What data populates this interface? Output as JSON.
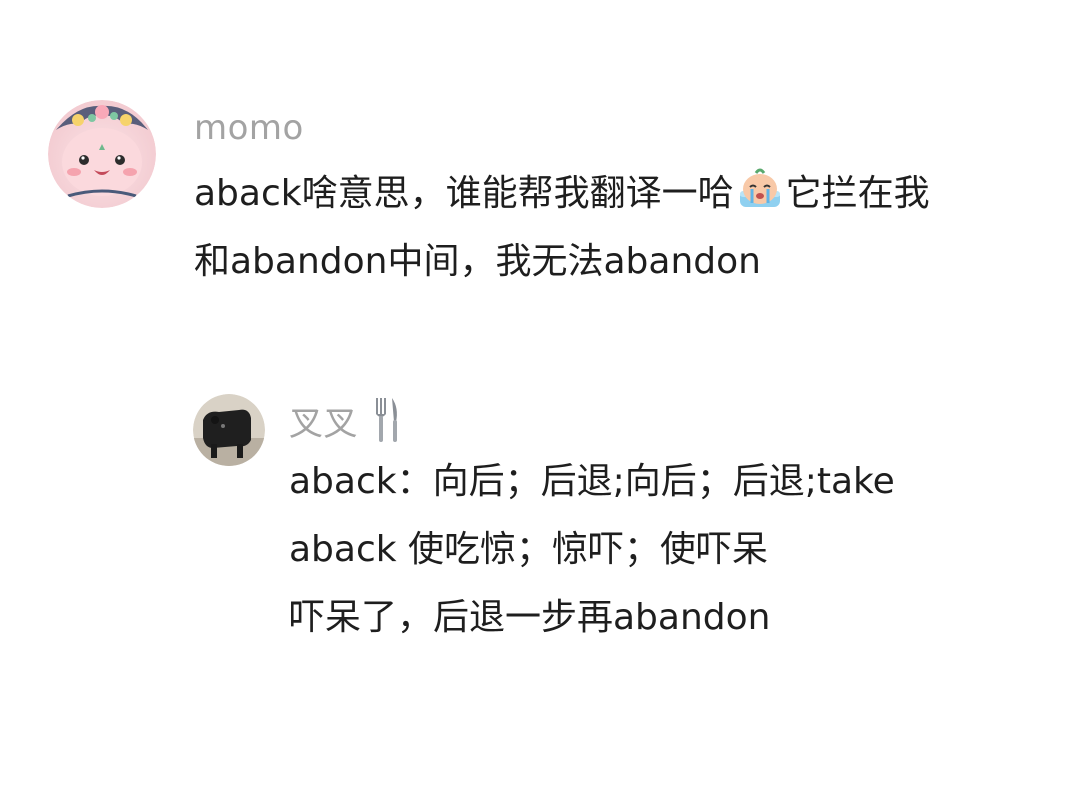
{
  "main_comment": {
    "username": "momo",
    "text_line1_part1": "aback啥意思，谁能帮我翻译一哈",
    "emoji": "crying-face-emoji",
    "text_line1_part2": "它拦在我",
    "text_line2": "和abandon中间，我无法abandon"
  },
  "reply": {
    "username": "叉叉",
    "name_icon": "fork-knife-icon",
    "lines": [
      "aback：向后；后退;向后；后退;take",
      "aback 使吃惊；惊吓；使吓呆",
      "吓呆了，后退一步再abandon"
    ]
  }
}
